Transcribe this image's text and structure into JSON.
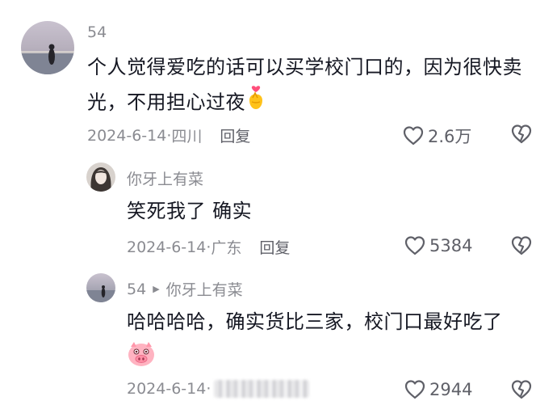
{
  "comments": [
    {
      "user": "54",
      "text": "个人觉得爱吃的话可以买学校门口的，因为很快卖光，不用担心过夜",
      "emoji": "finger-heart",
      "date": "2024-6-14",
      "location": "四川",
      "reply_label": "回复",
      "likes": "2.6万"
    },
    {
      "user": "你牙上有菜",
      "text": "笑死我了 确实",
      "date": "2024-6-14",
      "location": "广东",
      "reply_label": "回复",
      "likes": "5384"
    },
    {
      "user": "54",
      "reply_to": "你牙上有菜",
      "text": "哈哈哈哈，确实货比三家，校门口最好吃了",
      "emoji": "pig-face",
      "date": "2024-6-14",
      "likes": "2944"
    }
  ],
  "separator": "·",
  "colors": {
    "text": "#161823",
    "meta": "#8a8b91",
    "icon": "#5f6068"
  }
}
